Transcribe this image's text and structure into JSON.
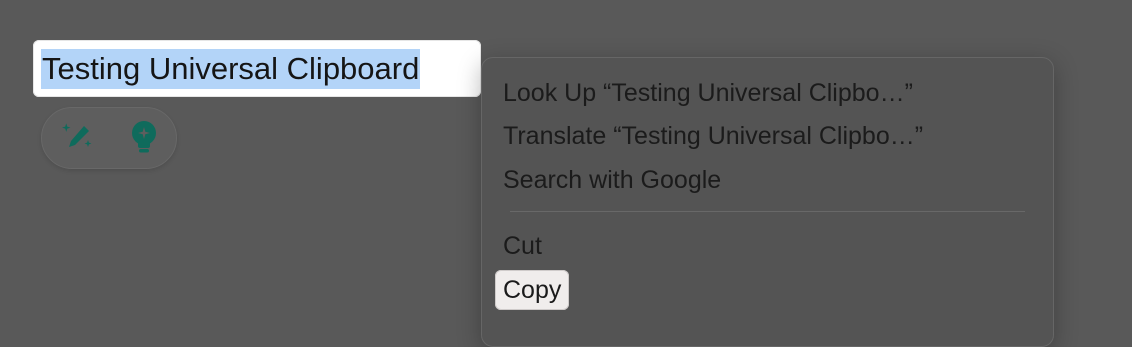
{
  "text_field": {
    "selected_text": "Testing Universal Clipboard"
  },
  "writing_tools": {
    "write_icon": "pen-sparkles-icon",
    "summarize_icon": "lightbulb-icon",
    "icon_color": "#0f6b5c"
  },
  "context_menu": {
    "items": [
      {
        "label": "Look Up “Testing Universal Clipbo…”"
      },
      {
        "label": "Translate “Testing Universal Clipbo…”"
      },
      {
        "label": "Search with Google"
      },
      {
        "label": "Cut"
      },
      {
        "label": "Copy",
        "highlighted": true
      }
    ]
  }
}
